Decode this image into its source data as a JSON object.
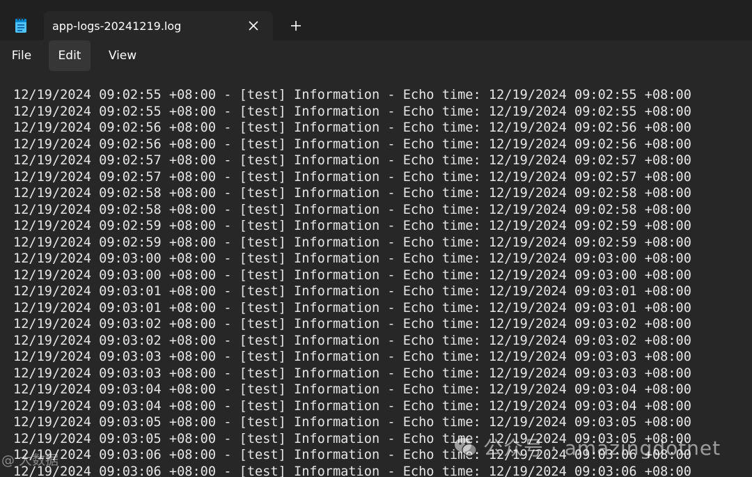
{
  "window": {
    "tab_title": "app-logs-20241219.log",
    "icons": {
      "app": "notepad-icon",
      "close": "close-icon",
      "new_tab": "plus-icon"
    },
    "colors": {
      "titlebar": "#202020",
      "editor_bg": "#272727",
      "text": "#e6e6e6",
      "menu_active_bg": "#363636"
    }
  },
  "menu": {
    "file_label": "File",
    "edit_label": "Edit",
    "view_label": "View"
  },
  "editor": {
    "lines": [
      "12/19/2024 09:02:55 +08:00 - [test] Information - Echo time: 12/19/2024 09:02:55 +08:00",
      "12/19/2024 09:02:55 +08:00 - [test] Information - Echo time: 12/19/2024 09:02:55 +08:00",
      "12/19/2024 09:02:56 +08:00 - [test] Information - Echo time: 12/19/2024 09:02:56 +08:00",
      "12/19/2024 09:02:56 +08:00 - [test] Information - Echo time: 12/19/2024 09:02:56 +08:00",
      "12/19/2024 09:02:57 +08:00 - [test] Information - Echo time: 12/19/2024 09:02:57 +08:00",
      "12/19/2024 09:02:57 +08:00 - [test] Information - Echo time: 12/19/2024 09:02:57 +08:00",
      "12/19/2024 09:02:58 +08:00 - [test] Information - Echo time: 12/19/2024 09:02:58 +08:00",
      "12/19/2024 09:02:58 +08:00 - [test] Information - Echo time: 12/19/2024 09:02:58 +08:00",
      "12/19/2024 09:02:59 +08:00 - [test] Information - Echo time: 12/19/2024 09:02:59 +08:00",
      "12/19/2024 09:02:59 +08:00 - [test] Information - Echo time: 12/19/2024 09:02:59 +08:00",
      "12/19/2024 09:03:00 +08:00 - [test] Information - Echo time: 12/19/2024 09:03:00 +08:00",
      "12/19/2024 09:03:00 +08:00 - [test] Information - Echo time: 12/19/2024 09:03:00 +08:00",
      "12/19/2024 09:03:01 +08:00 - [test] Information - Echo time: 12/19/2024 09:03:01 +08:00",
      "12/19/2024 09:03:01 +08:00 - [test] Information - Echo time: 12/19/2024 09:03:01 +08:00",
      "12/19/2024 09:03:02 +08:00 - [test] Information - Echo time: 12/19/2024 09:03:02 +08:00",
      "12/19/2024 09:03:02 +08:00 - [test] Information - Echo time: 12/19/2024 09:03:02 +08:00",
      "12/19/2024 09:03:03 +08:00 - [test] Information - Echo time: 12/19/2024 09:03:03 +08:00",
      "12/19/2024 09:03:03 +08:00 - [test] Information - Echo time: 12/19/2024 09:03:03 +08:00",
      "12/19/2024 09:03:04 +08:00 - [test] Information - Echo time: 12/19/2024 09:03:04 +08:00",
      "12/19/2024 09:03:04 +08:00 - [test] Information - Echo time: 12/19/2024 09:03:04 +08:00",
      "12/19/2024 09:03:05 +08:00 - [test] Information - Echo time: 12/19/2024 09:03:05 +08:00",
      "12/19/2024 09:03:05 +08:00 - [test] Information - Echo time: 12/19/2024 09:03:05 +08:00",
      "12/19/2024 09:03:06 +08:00 - [test] Information - Echo time: 12/19/2024 09:03:06 +08:00",
      "12/19/2024 09:03:06 +08:00 - [test] Information - Echo time: 12/19/2024 09:03:06 +08:00"
    ]
  },
  "watermark": {
    "left_text": "@ 大数据",
    "right_text": "公众号 · amazingdotnet",
    "icon": "wechat-logo-icon"
  }
}
